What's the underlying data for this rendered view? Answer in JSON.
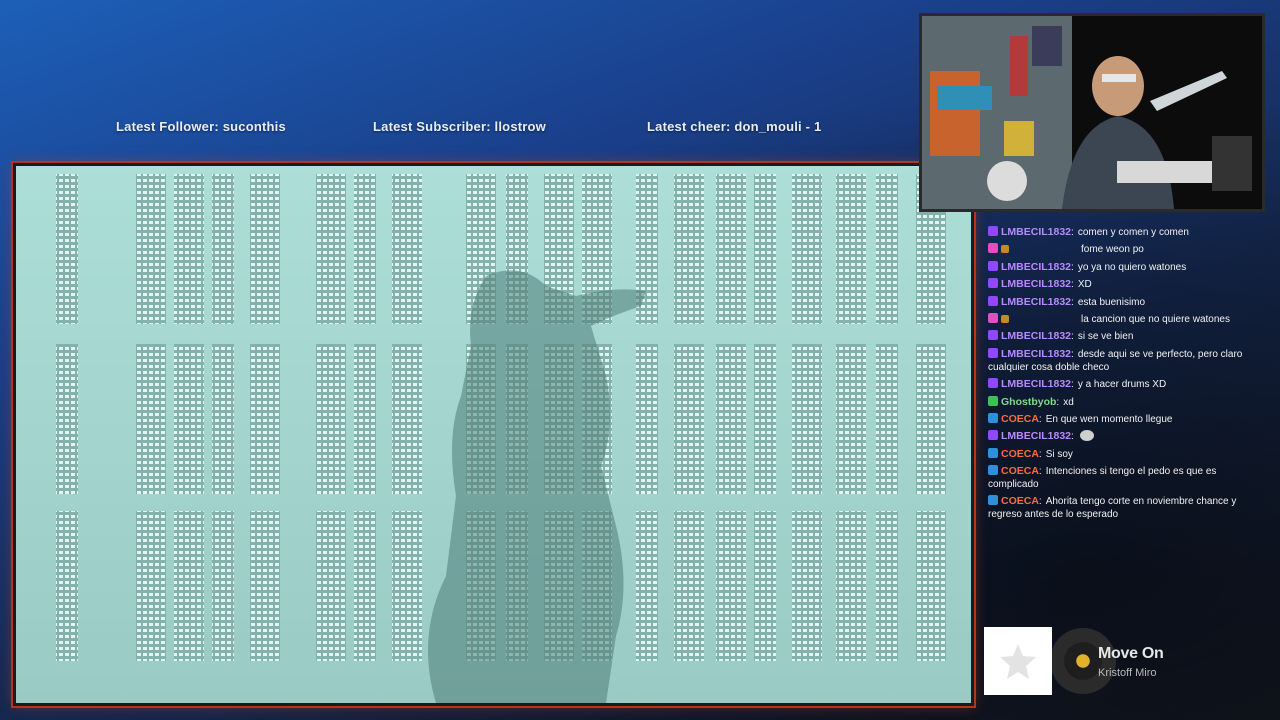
{
  "overlay": {
    "latest_follower": "Latest Follower: suconthis",
    "latest_subscriber": "Latest Subscriber: llostrow",
    "latest_cheer": "Latest cheer: don_mouli - 1"
  },
  "chat": {
    "messages": [
      {
        "badge": "purple",
        "user": "LMBECIL1832",
        "user_color": "#b889ff",
        "text": "comen y comen y comen"
      },
      {
        "badge": "pink",
        "gift": true,
        "user": "",
        "user_color": "#c0392b",
        "text": "fome weon po"
      },
      {
        "badge": "purple",
        "user": "LMBECIL1832",
        "user_color": "#b889ff",
        "text": "yo ya no quiero watones"
      },
      {
        "badge": "purple",
        "user": "LMBECIL1832",
        "user_color": "#b889ff",
        "text": "XD"
      },
      {
        "badge": "purple",
        "user": "LMBECIL1832",
        "user_color": "#b889ff",
        "text": "esta buenisimo"
      },
      {
        "badge": "pink",
        "gift": true,
        "user": "",
        "user_color": "#c0392b",
        "text": "la cancion que no quiere watones"
      },
      {
        "badge": "purple",
        "user": "LMBECIL1832",
        "user_color": "#b889ff",
        "text": "si se ve bien"
      },
      {
        "badge": "purple",
        "user": "LMBECIL1832",
        "user_color": "#b889ff",
        "text": "desde aqui se ve perfecto, pero claro cualquier cosa doble checo"
      },
      {
        "badge": "purple",
        "user": "LMBECIL1832",
        "user_color": "#b889ff",
        "text": "y a hacer drums XD"
      },
      {
        "badge": "green",
        "user": "Ghostbyob",
        "user_color": "#7fdc8a",
        "text": "xd"
      },
      {
        "badge": "blue",
        "user": "COECA",
        "user_color": "#ff6a3d",
        "text": "En que wen momento llegue"
      },
      {
        "badge": "purple",
        "user": "LMBECIL1832",
        "user_color": "#b889ff",
        "text": "",
        "emote": true
      },
      {
        "badge": "blue",
        "user": "COECA",
        "user_color": "#ff6a3d",
        "text": "Si soy"
      },
      {
        "badge": "blue",
        "user": "COECA",
        "user_color": "#ff6a3d",
        "text": "Intenciones si tengo el pedo es que es complicado"
      },
      {
        "badge": "blue",
        "user": "COECA",
        "user_color": "#ff6a3d",
        "text": "Ahorita tengo corte en noviembre chance y regreso antes de lo esperado"
      }
    ]
  },
  "now_playing": {
    "title": "Move On",
    "artist": "Kristoff Miro",
    "art_icon": "star-icon",
    "disc_icon": "vinyl-icon"
  },
  "colors": {
    "frame_border": "#b4351e",
    "background": "#1a3f8a"
  }
}
